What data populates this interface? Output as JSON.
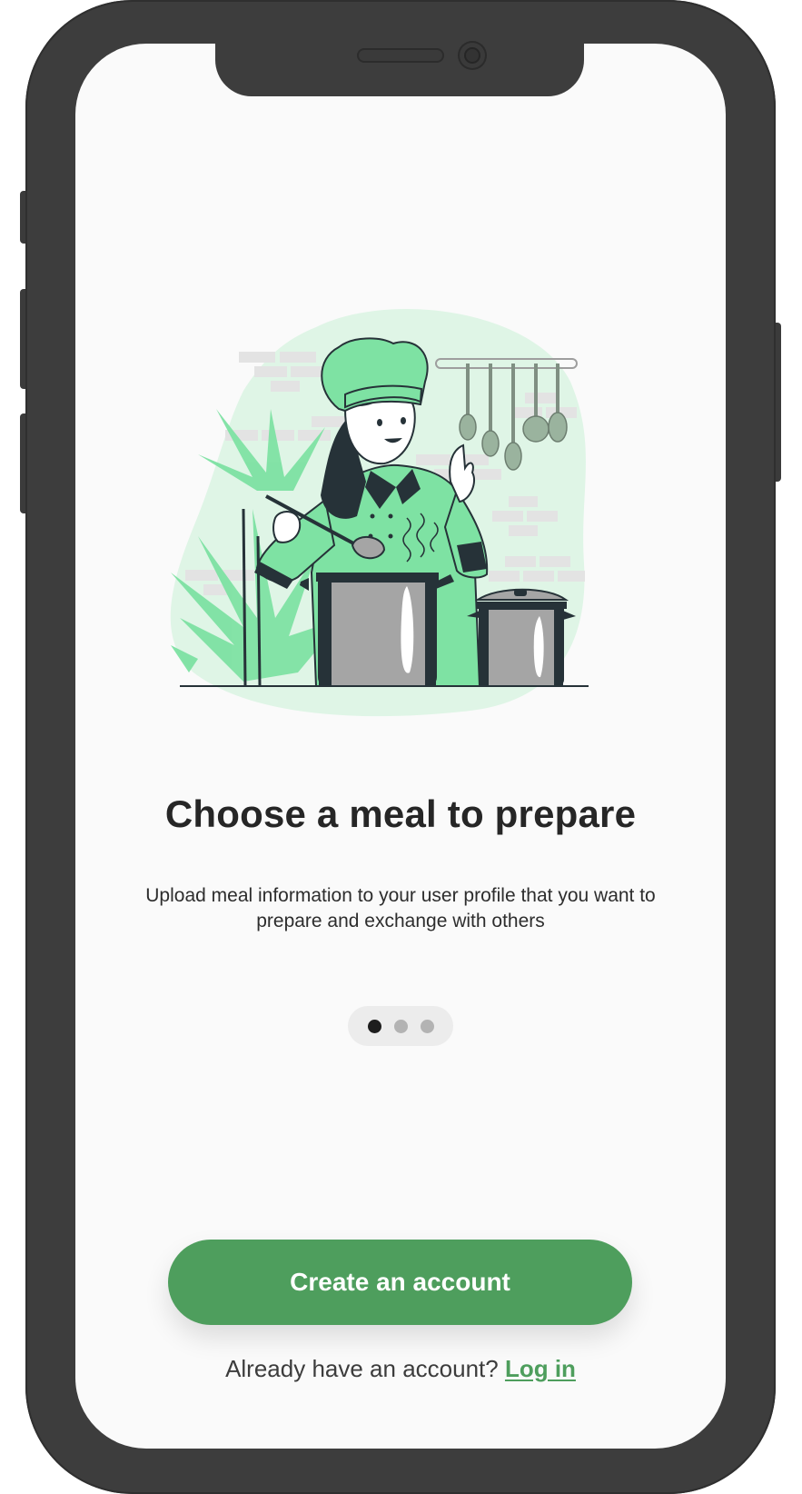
{
  "onboarding": {
    "title": "Choose a meal to prepare",
    "description": "Upload meal information to your user profile that you want to prepare and exchange with others",
    "pagination": {
      "current": 1,
      "total": 3
    },
    "primary_button": "Create an account",
    "login_prompt": "Already have an account?",
    "login_link": "Log in"
  },
  "colors": {
    "accent": "#4e9e5d",
    "illustration_green": "#7ee2a3",
    "illustration_bg": "#dff5e6",
    "pot_gray": "#a5a5a5",
    "dark": "#263238"
  },
  "icons": {
    "illustration": "chef-cooking-illustration"
  }
}
